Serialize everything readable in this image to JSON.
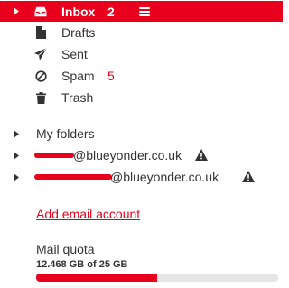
{
  "folders": {
    "inbox": {
      "label": "Inbox",
      "count": "2"
    },
    "drafts": {
      "label": "Drafts"
    },
    "sent": {
      "label": "Sent"
    },
    "spam": {
      "label": "Spam",
      "count": "5"
    },
    "trash": {
      "label": "Trash"
    }
  },
  "my_folders": {
    "label": "My folders"
  },
  "accounts": [
    {
      "visible_suffix": "@blueyonder.co.uk"
    },
    {
      "visible_suffix": "@blueyonder.co.uk"
    }
  ],
  "add_account": {
    "label": "Add email account"
  },
  "quota": {
    "title": "Mail quota",
    "usage_text": "12.468 GB of 25 GB",
    "used_fraction": 0.499
  },
  "colors": {
    "accent": "#e8001c",
    "text": "#333333",
    "warning": "#333333"
  },
  "icons": {
    "inbox": "inbox-tray-icon",
    "drafts": "document-icon",
    "sent": "paper-plane-icon",
    "spam": "prohibited-icon",
    "trash": "trash-can-icon",
    "menu": "hamburger-icon",
    "expand": "caret-right-icon",
    "warning": "warning-triangle-icon"
  }
}
